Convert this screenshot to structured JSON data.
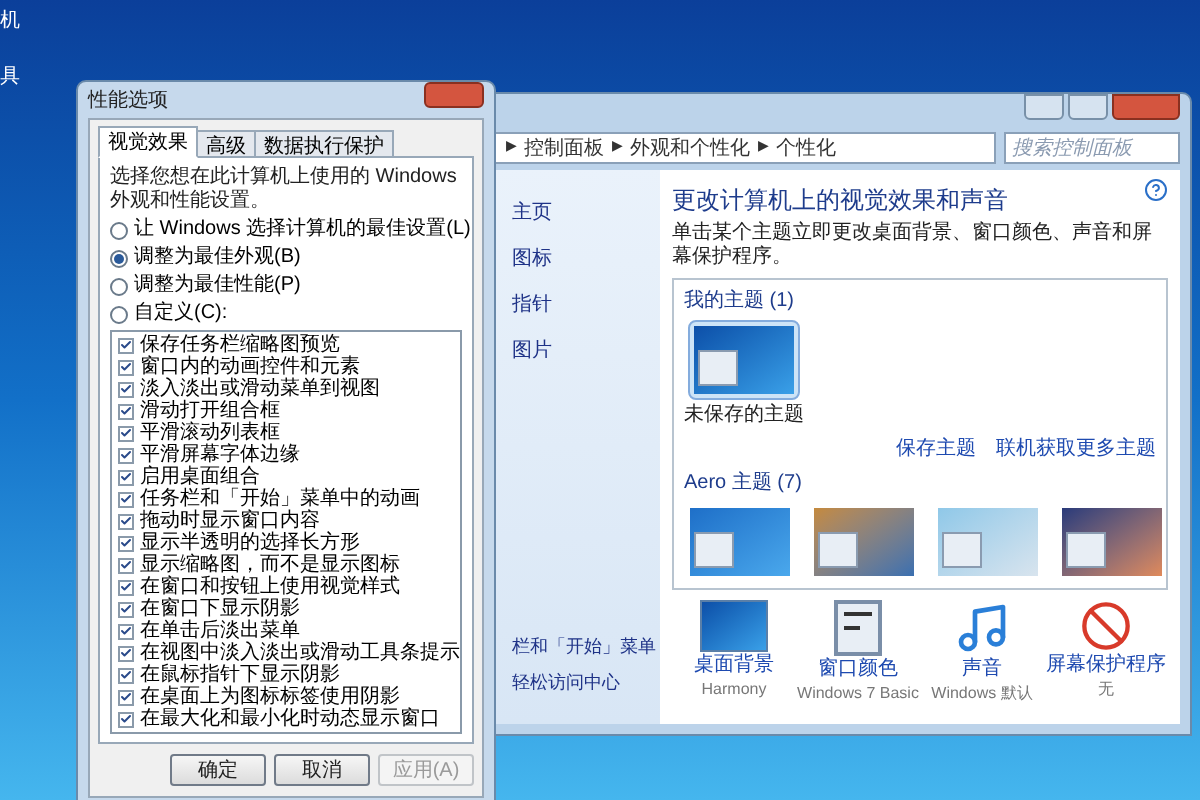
{
  "desktop_icons": [
    {
      "label": "机"
    },
    {
      "label": "具"
    }
  ],
  "performance_dialog": {
    "title": "性能选项",
    "tabs": [
      {
        "label": "视觉效果",
        "selected": true
      },
      {
        "label": "高级",
        "selected": false
      },
      {
        "label": "数据执行保护",
        "selected": false
      }
    ],
    "description": "选择您想在此计算机上使用的 Windows 外观和性能设置。",
    "options": [
      {
        "label": "让 Windows 选择计算机的最佳设置(L)",
        "selected": false
      },
      {
        "label": "调整为最佳外观(B)",
        "selected": true
      },
      {
        "label": "调整为最佳性能(P)",
        "selected": false
      },
      {
        "label": "自定义(C):",
        "selected": false
      }
    ],
    "effects": [
      {
        "label": "保存任务栏缩略图预览",
        "checked": true
      },
      {
        "label": "窗口内的动画控件和元素",
        "checked": true
      },
      {
        "label": "淡入淡出或滑动菜单到视图",
        "checked": true
      },
      {
        "label": "滑动打开组合框",
        "checked": true
      },
      {
        "label": "平滑滚动列表框",
        "checked": true
      },
      {
        "label": "平滑屏幕字体边缘",
        "checked": true
      },
      {
        "label": "启用桌面组合",
        "checked": true
      },
      {
        "label": "任务栏和「开始」菜单中的动画",
        "checked": true
      },
      {
        "label": "拖动时显示窗口内容",
        "checked": true
      },
      {
        "label": "显示半透明的选择长方形",
        "checked": true
      },
      {
        "label": "显示缩略图，而不是显示图标",
        "checked": true
      },
      {
        "label": "在窗口和按钮上使用视觉样式",
        "checked": true
      },
      {
        "label": "在窗口下显示阴影",
        "checked": true
      },
      {
        "label": "在单击后淡出菜单",
        "checked": true
      },
      {
        "label": "在视图中淡入淡出或滑动工具条提示",
        "checked": true
      },
      {
        "label": "在鼠标指针下显示阴影",
        "checked": true
      },
      {
        "label": "在桌面上为图标标签使用阴影",
        "checked": true
      },
      {
        "label": "在最大化和最小化时动态显示窗口",
        "checked": true
      }
    ],
    "buttons": [
      {
        "label": "确定",
        "disabled": false
      },
      {
        "label": "取消",
        "disabled": false
      },
      {
        "label": "应用(A)",
        "disabled": true
      }
    ]
  },
  "personalization_window": {
    "breadcrumb": [
      {
        "arrow": "▶",
        "label": "控制面板"
      },
      {
        "arrow": "▶",
        "label": "外观和个性化"
      },
      {
        "arrow": "▶",
        "label": "个性化"
      }
    ],
    "search": {
      "placeholder": "搜索控制面板"
    },
    "sidebar": {
      "items": [
        "主页",
        "图标",
        "指针",
        "图片"
      ],
      "see_also": [
        "栏和「开始」菜单",
        "轻松访问中心"
      ]
    },
    "heading": "更改计算机上的视觉效果和声音",
    "description": "单击某个主题立即更改桌面背景、窗口颜色、声音和屏幕保护程序。",
    "my_themes": {
      "label": "我的主题 (1)",
      "themes": [
        {
          "name": "未保存的主题",
          "selected": true
        }
      ]
    },
    "links": [
      "保存主题",
      "联机获取更多主题"
    ],
    "aero_themes": {
      "label": "Aero 主题 (7)",
      "themes": [
        {
          "selected": false
        },
        {
          "selected": false
        },
        {
          "selected": false
        },
        {
          "selected": false
        }
      ]
    },
    "settings": [
      {
        "label": "桌面背景",
        "value": "Harmony",
        "kind": "background"
      },
      {
        "label": "窗口颜色",
        "value": "Windows 7 Basic",
        "kind": "color"
      },
      {
        "label": "声音",
        "value": "Windows 默认",
        "kind": "sound"
      },
      {
        "label": "屏幕保护程序",
        "value": "无",
        "kind": "screensaver"
      }
    ]
  }
}
